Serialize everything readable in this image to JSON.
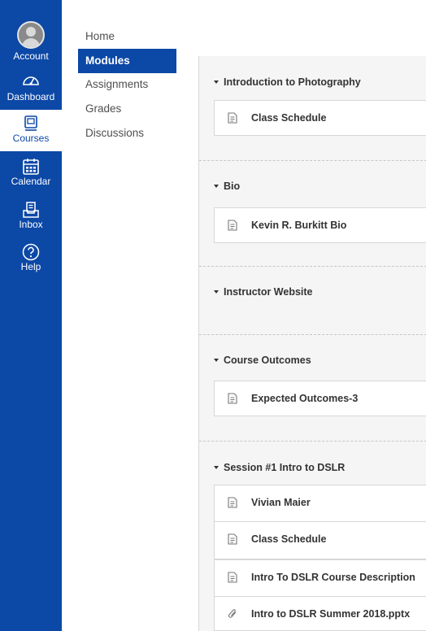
{
  "global_nav": {
    "items": [
      {
        "label": "Account",
        "icon": "avatar"
      },
      {
        "label": "Dashboard",
        "icon": "dashboard-icon"
      },
      {
        "label": "Courses",
        "icon": "courses-icon",
        "active": true
      },
      {
        "label": "Calendar",
        "icon": "calendar-icon"
      },
      {
        "label": "Inbox",
        "icon": "inbox-icon"
      },
      {
        "label": "Help",
        "icon": "help-icon"
      }
    ],
    "colors": {
      "background": "#0c48a6",
      "active_text": "#0c48a6"
    }
  },
  "course_nav": {
    "items": [
      {
        "label": "Home"
      },
      {
        "label": "Modules",
        "active": true
      },
      {
        "label": "Assignments"
      },
      {
        "label": "Grades"
      },
      {
        "label": "Discussions"
      }
    ]
  },
  "modules": [
    {
      "title": "Introduction to Photography",
      "items": [
        {
          "title": "Class Schedule",
          "icon": "page-icon"
        }
      ]
    },
    {
      "title": "Bio",
      "items": [
        {
          "title": "Kevin R. Burkitt Bio",
          "icon": "page-icon"
        }
      ]
    },
    {
      "title": "Instructor Website",
      "items": []
    },
    {
      "title": "Course Outcomes",
      "items": [
        {
          "title": "Expected Outcomes-3",
          "icon": "page-icon"
        }
      ]
    },
    {
      "title": "Session #1 Intro to DSLR",
      "items": [
        {
          "title": "Vivian Maier",
          "icon": "page-icon"
        },
        {
          "title": "Class Schedule",
          "icon": "page-icon"
        },
        {
          "title": "Intro To DSLR Course Description",
          "icon": "page-icon"
        },
        {
          "title": "Intro to DSLR Summer 2018.pptx",
          "icon": "attachment-icon"
        }
      ]
    }
  ]
}
